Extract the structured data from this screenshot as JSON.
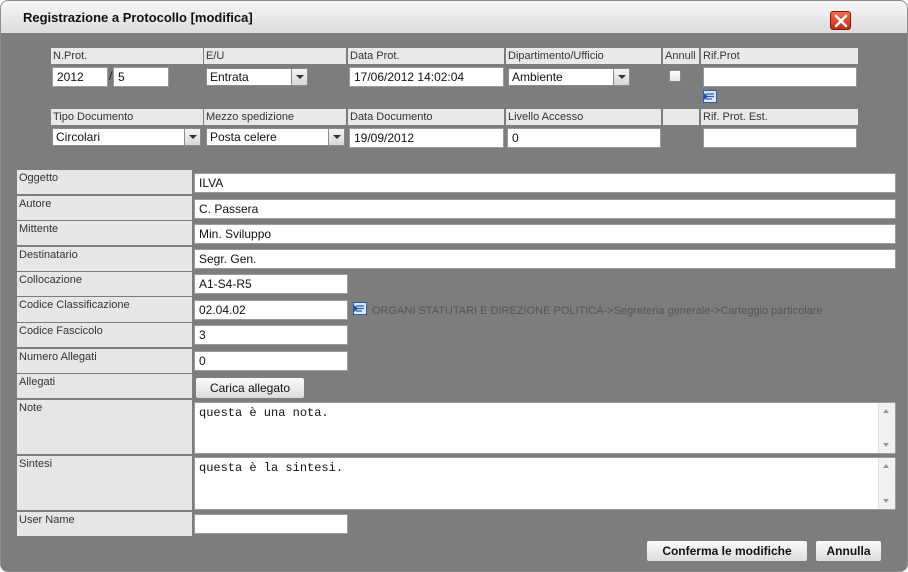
{
  "window": {
    "title": "Registrazione a Protocollo [modifica]"
  },
  "header_row1": {
    "labels": {
      "nprot": "N.Prot.",
      "eu": "E/U",
      "data_prot": "Data Prot.",
      "dipartimento": "Dipartimento/Ufficio",
      "annulla": "Annull",
      "rif_prot": "Rif.Prot"
    },
    "nprot_year": "2012",
    "nprot_separator": "/",
    "nprot_number": "5",
    "eu_value": "Entrata",
    "data_prot_value": "17/06/2012 14:02:04",
    "dipartimento_value": "Ambiente",
    "rif_prot_value": ""
  },
  "header_row2": {
    "labels": {
      "tipo_documento": "Tipo Documento",
      "mezzo_spedizione": "Mezzo spedizione",
      "data_documento": "Data Documento",
      "livello_accesso": "Livello Accesso",
      "rif_prot_est": "Rif. Prot. Est."
    },
    "tipo_documento_value": "Circolari",
    "mezzo_spedizione_value": "Posta celere",
    "data_documento_value": "19/09/2012",
    "livello_accesso_value": "0",
    "rif_prot_est_value": ""
  },
  "form": {
    "oggetto": {
      "label": "Oggetto",
      "value": "ILVA"
    },
    "autore": {
      "label": "Autore",
      "value": "C. Passera"
    },
    "mittente": {
      "label": "Mittente",
      "value": "Min. Sviluppo"
    },
    "destinatario": {
      "label": "Destinatario",
      "value": "Segr. Gen."
    },
    "collocazione": {
      "label": "Collocazione",
      "value": "A1-S4-R5"
    },
    "codice_classificazione": {
      "label": "Codice Classificazione",
      "value": "02.04.02",
      "path": "ORGANI STATUTARI E DIREZIONE POLITICA->Segreteria generale->Carteggio particolare"
    },
    "codice_fascicolo": {
      "label": "Codice Fascicolo",
      "value": "3"
    },
    "numero_allegati": {
      "label": "Numero Allegati",
      "value": "0"
    },
    "allegati": {
      "label": "Allegati",
      "button": "Carica allegato"
    },
    "note": {
      "label": "Note",
      "value": "questa è una nota."
    },
    "sintesi": {
      "label": "Sintesi",
      "value": "questa è la sintesi."
    },
    "user_name": {
      "label": "User Name",
      "value": ""
    }
  },
  "footer": {
    "confirm_label": "Conferma le modifiche",
    "cancel_label": "Annulla"
  },
  "colors": {
    "dialog_bg": "#7d7d7d",
    "close_button": "#d9381c",
    "label_bg": "#e6e6e6"
  }
}
